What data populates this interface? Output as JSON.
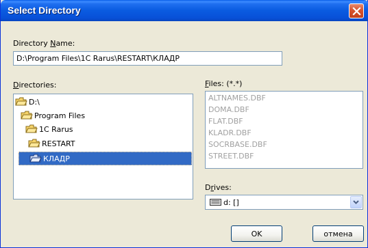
{
  "window": {
    "title": "Select Directory"
  },
  "directory_name": {
    "label_pre": "Directory ",
    "label_accel": "N",
    "label_post": "ame:",
    "value": "D:\\Program Files\\1C Rarus\\RESTART\\КЛАДР"
  },
  "directories": {
    "label_accel": "D",
    "label_post": "irectories:",
    "items": [
      {
        "label": "D:\\",
        "state": "open"
      },
      {
        "label": "Program Files",
        "state": "open"
      },
      {
        "label": "1C Rarus",
        "state": "open"
      },
      {
        "label": "RESTART",
        "state": "open"
      },
      {
        "label": "КЛАДР",
        "state": "open",
        "selected": true
      }
    ]
  },
  "files": {
    "label_accel": "F",
    "label_post": "iles: (*.*)",
    "items": [
      "ALTNAMES.DBF",
      "DOMA.DBF",
      "FLAT.DBF",
      "KLADR.DBF",
      "SOCRBASE.DBF",
      "STREET.DBF"
    ]
  },
  "drives": {
    "label_pre": "D",
    "label_accel": "r",
    "label_post": "ives:",
    "selected": "d: []",
    "icon": "drive-icon"
  },
  "buttons": {
    "ok": "OK",
    "cancel": "отмена"
  },
  "colors": {
    "titlebar": "#0a5be0",
    "selection": "#316ac5",
    "close": "#d8532d"
  }
}
